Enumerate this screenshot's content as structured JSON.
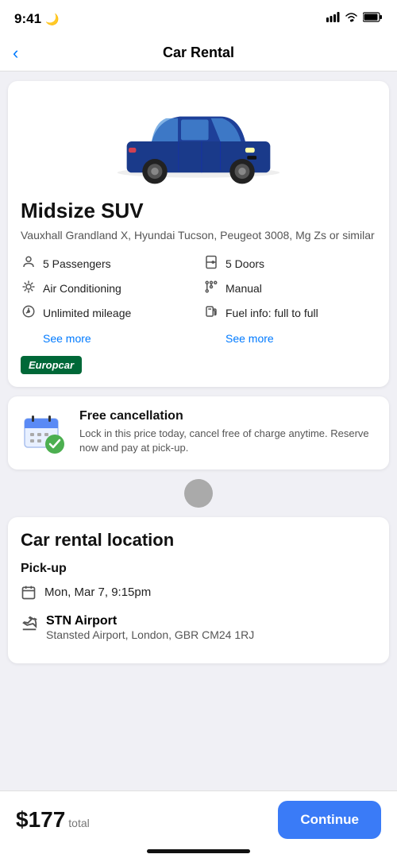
{
  "statusBar": {
    "time": "9:41",
    "moonIcon": "🌙"
  },
  "header": {
    "title": "Car Rental",
    "backIcon": "‹"
  },
  "carCard": {
    "carTitle": "Midsize SUV",
    "carSubtitle": "Vauxhall Grandland X, Hyundai Tucson, Peugeot 3008, Mg Zs or similar",
    "features": [
      {
        "icon": "👤",
        "label": "5 Passengers"
      },
      {
        "icon": "🚪",
        "label": "5 Doors"
      },
      {
        "icon": "❄️",
        "label": "Air Conditioning"
      },
      {
        "icon": "⚙️",
        "label": "Manual"
      },
      {
        "icon": "⏱️",
        "label": "Unlimited mileage"
      },
      {
        "icon": "⛽",
        "label": "Fuel info: full to full"
      }
    ],
    "seeMore1": "See more",
    "seeMore2": "See more",
    "provider": "Europcar"
  },
  "cancellation": {
    "title": "Free cancellation",
    "description": "Lock in this price today, cancel free of charge anytime. Reserve now and pay at pick-up."
  },
  "location": {
    "sectionTitle": "Car rental location",
    "pickupLabel": "Pick-up",
    "pickupDate": "Mon, Mar 7, 9:15pm",
    "airportName": "STN Airport",
    "airportAddress": "Stansted Airport, London, GBR CM24 1RJ"
  },
  "bottomBar": {
    "price": "$177",
    "priceLabel": "total",
    "continueLabel": "Continue"
  }
}
